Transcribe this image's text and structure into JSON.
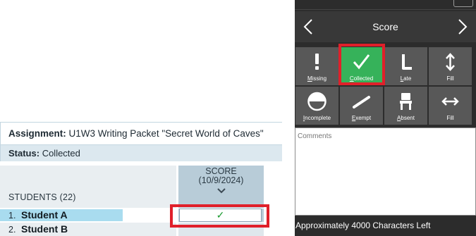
{
  "assignment": {
    "label": "Assignment:",
    "value": "U1W3 Writing Packet \"Secret World of Caves\""
  },
  "status": {
    "label": "Status:",
    "value": "Collected"
  },
  "students_header": "STUDENTS (22)",
  "score_column": {
    "title": "SCORE",
    "date": "(10/9/2024)"
  },
  "students": [
    {
      "num": "1.",
      "name": "Student A",
      "score": "✓"
    },
    {
      "num": "2.",
      "name": "Student B",
      "score": ""
    }
  ],
  "panel": {
    "title": "Score",
    "tiles": [
      {
        "key": "M",
        "rest": "issing",
        "icon": "exclamation-icon",
        "active": false
      },
      {
        "key": "C",
        "rest": "ollected",
        "icon": "checkmark-icon",
        "active": true
      },
      {
        "key": "L",
        "rest": "ate",
        "icon": "late-icon",
        "active": false
      },
      {
        "key": "",
        "rest": "Fill",
        "icon": "vertical-arrows-icon",
        "active": false
      },
      {
        "key": "I",
        "rest": "ncomplete",
        "icon": "half-circle-icon",
        "active": false
      },
      {
        "key": "E",
        "rest": "xempt",
        "icon": "slash-icon",
        "active": false
      },
      {
        "key": "A",
        "rest": "bsent",
        "icon": "chair-icon",
        "active": false
      },
      {
        "key": "",
        "rest": "Fill",
        "icon": "horizontal-arrows-icon",
        "active": false
      }
    ],
    "comments_placeholder": "Comments",
    "chars_left": "Approximately 4000 Characters Left"
  },
  "colors": {
    "active_tile": "#36b25a",
    "highlight": "#e0202a",
    "check": "#1a9a2f"
  }
}
